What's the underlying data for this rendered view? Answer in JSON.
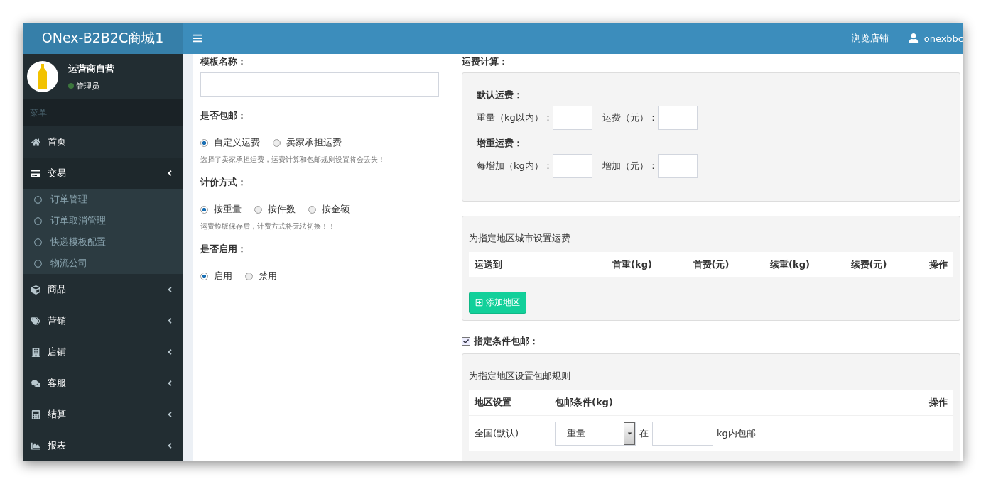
{
  "header": {
    "logo": "ONex-B2B2C商城1",
    "links": [
      "浏览店铺"
    ],
    "user": "onexbbc"
  },
  "sidebar": {
    "user": {
      "name": "运营商自营",
      "role": "管理员",
      "online": true
    },
    "menu_header": "菜单",
    "items": [
      {
        "label": "首页",
        "selected": false,
        "has_caret": false
      },
      {
        "label": "交易",
        "selected": true,
        "has_caret": true,
        "children": [
          {
            "label": "订单管理"
          },
          {
            "label": "订单取消管理"
          },
          {
            "label": "快递模板配置"
          },
          {
            "label": "物流公司"
          }
        ]
      },
      {
        "label": "商品",
        "selected": false,
        "has_caret": true
      },
      {
        "label": "营销",
        "selected": false,
        "has_caret": true
      },
      {
        "label": "店铺",
        "selected": false,
        "has_caret": true
      },
      {
        "label": "客服",
        "selected": false,
        "has_caret": true
      },
      {
        "label": "结算",
        "selected": false,
        "has_caret": true
      },
      {
        "label": "报表",
        "selected": false,
        "has_caret": true
      }
    ]
  },
  "form": {
    "template_name": {
      "label": "模板名称："
    },
    "groups": [
      {
        "label": "是否包邮：",
        "options": [
          {
            "label": "自定义运费",
            "selected": true
          },
          {
            "label": "卖家承担运费",
            "selected": false
          }
        ],
        "note": "选择了卖家承担运费，运费计算和包邮规则设置将会丢失！"
      },
      {
        "label": "计价方式：",
        "options": [
          {
            "label": "按重量",
            "selected": true
          },
          {
            "label": "按件数",
            "selected": false
          },
          {
            "label": "按金额",
            "selected": false
          }
        ],
        "note": "运费模版保存后，计费方式将无法切换！！"
      },
      {
        "label": "是否启用：",
        "options": [
          {
            "label": "启用",
            "selected": true
          },
          {
            "label": "禁用",
            "selected": false
          }
        ]
      }
    ]
  },
  "freight": {
    "title": "运费计算：",
    "sections": [
      {
        "title": "默认运费：",
        "fields": [
          {
            "label": "重量（kg以内）："
          },
          {
            "label": "运费（元）："
          }
        ]
      },
      {
        "title": "增重运费：",
        "fields": [
          {
            "label": "每增加（kg内）："
          },
          {
            "label": "增加（元）："
          }
        ]
      }
    ]
  },
  "area_fees": {
    "title": "为指定地区城市设置运费",
    "columns": [
      "运送到",
      "首重(kg)",
      "首费(元)",
      "续重(kg)",
      "续费(元)",
      "操作"
    ],
    "add_button": "添加地区"
  },
  "free_shipping": {
    "checked": true,
    "label": "指定条件包邮：",
    "title": "为指定地区设置包邮规则",
    "columns": [
      "地区设置",
      "包邮条件(kg)",
      "操作"
    ],
    "rows": [
      {
        "region": "全国(默认)",
        "condition": "重量",
        "at": "在",
        "suffix": "kg内包邮"
      }
    ]
  }
}
